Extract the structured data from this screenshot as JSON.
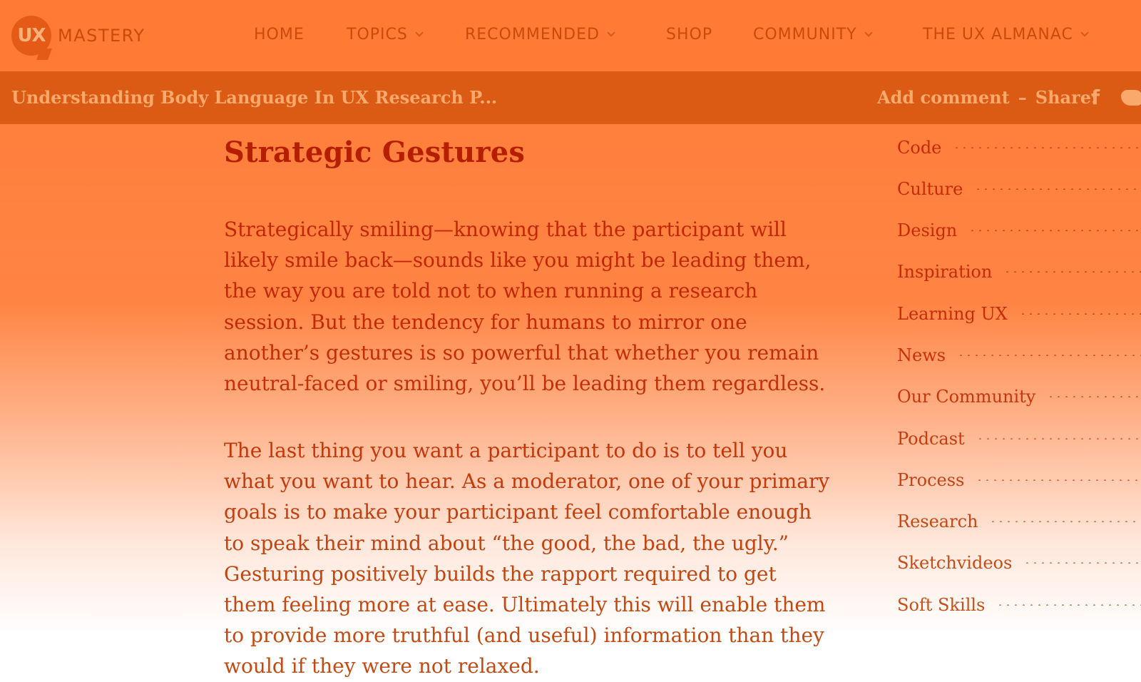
{
  "logo": {
    "badge": "UX",
    "text": "MASTERY"
  },
  "nav": [
    {
      "label": "HOME",
      "dropdown": false
    },
    {
      "label": "TOPICS",
      "dropdown": true
    },
    {
      "label": "RECOMMENDED",
      "dropdown": true
    },
    {
      "label": "SHOP",
      "dropdown": false
    },
    {
      "label": "COMMUNITY",
      "dropdown": true
    },
    {
      "label": "THE UX ALMANAC",
      "dropdown": true
    }
  ],
  "article_bar": {
    "title": "Understanding Body Language In UX Research P...",
    "add_comment": "Add comment",
    "separator": "–",
    "share": "Share:",
    "social_icons": [
      "facebook-icon",
      "twitter-icon"
    ]
  },
  "article": {
    "heading": "Strategic Gestures",
    "paragraphs": [
      "Strategically smiling—knowing that the participant will likely smile back—sounds like you might be leading them, the way you are told not to when running a research session. But the tendency for humans to mirror one another’s gestures is so powerful that whether you remain neutral-faced or smiling, you’ll be leading them regardless.",
      "The last thing you want a participant to do is to tell you what you want to hear. As a moderator, one of your primary goals is to make your participant feel comfortable enough to speak their mind about “the good, the bad, the ugly.” Gesturing positively builds the rapport required to get them feeling more at ease. Ultimately this will enable them to provide more truthful (and useful) information than they would if they were not relaxed."
    ]
  },
  "sidebar": {
    "categories": [
      "Code",
      "Culture",
      "Design",
      "Inspiration",
      "Learning UX",
      "News",
      "Our Community",
      "Podcast",
      "Process",
      "Research",
      "Sketchvideos",
      "Soft Skills"
    ]
  },
  "colors": {
    "overlay_orange": "#ff7a34",
    "article_bar": "#db5a14",
    "text_dark_orange": "#c34a12"
  }
}
